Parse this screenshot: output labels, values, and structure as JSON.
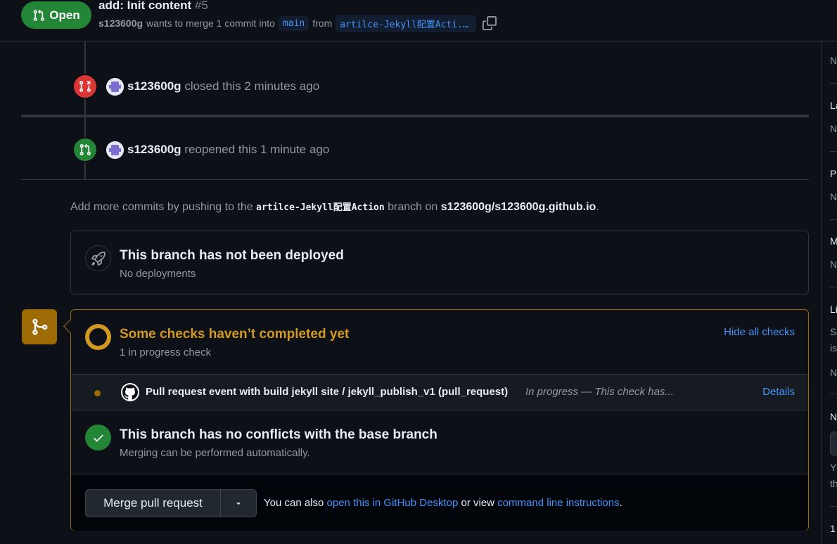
{
  "header": {
    "state_label": "Open",
    "title": "add: Init content",
    "number": "#5",
    "author": "s123600g",
    "merge_text": "wants to merge 1 commit into",
    "base_branch": "main",
    "from_text": "from",
    "head_branch": "artilce-Jekyll配置Acti..."
  },
  "timeline": {
    "closed_event": {
      "user": "s123600g",
      "text": "closed this 2 minutes ago"
    },
    "reopened_event": {
      "user": "s123600g",
      "text": "reopened this 1 minute ago"
    }
  },
  "hint": {
    "prefix": "Add more commits by pushing to the",
    "branch": "artilce-Jekyll配置Action",
    "middle": "branch on",
    "repo": "s123600g/s123600g.github.io",
    "suffix": "."
  },
  "deploy": {
    "title": "This branch has not been deployed",
    "subtitle": "No deployments"
  },
  "checks": {
    "title": "Some checks haven’t completed yet",
    "subtitle": "1 in progress check",
    "hide_all": "Hide all checks",
    "row": {
      "name": "Pull request event with build jekyll site / jekyll_publish_v1 (pull_request)",
      "status": "In progress — This check has...",
      "details": "Details"
    }
  },
  "conflicts": {
    "title": "This branch has no conflicts with the base branch",
    "subtitle": "Merging can be performed automatically."
  },
  "merge": {
    "button": "Merge pull request",
    "alt_prefix": "You can also",
    "alt_link1": "open this in GitHub Desktop",
    "alt_middle": "or view",
    "alt_link2": "command line instructions",
    "alt_suffix": "."
  },
  "sidebar": {
    "items": [
      "N",
      "La",
      "N",
      "Pl",
      "N",
      "M",
      "N",
      "Li",
      "Sı",
      "is",
      "N",
      "N",
      "Yc",
      "th",
      "1"
    ]
  },
  "colors": {
    "open": "#238636",
    "closed": "#da3633",
    "pending": "#d29922",
    "link": "#4493f8"
  }
}
